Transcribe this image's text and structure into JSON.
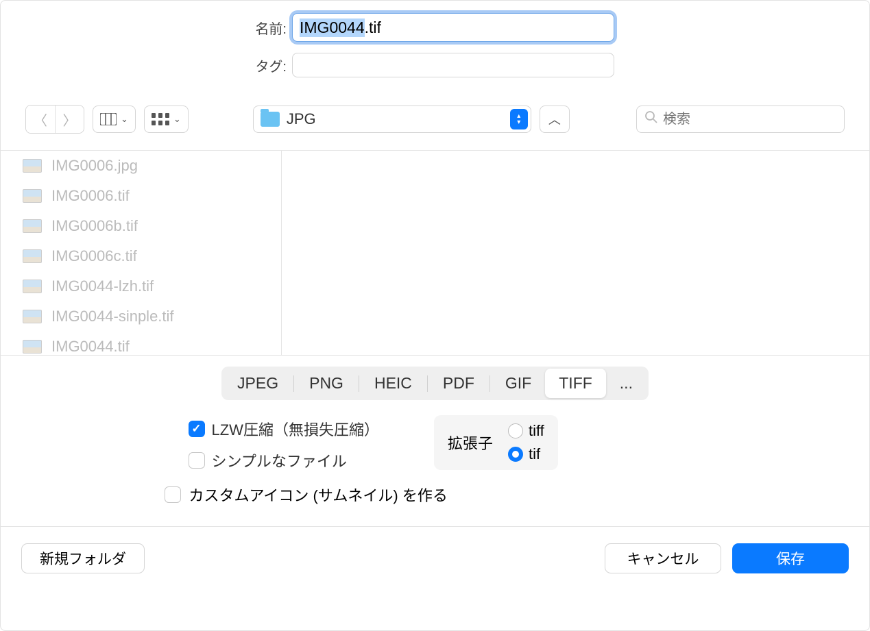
{
  "labels": {
    "name": "名前:",
    "tags": "タグ:"
  },
  "filename": "IMG0044.tif",
  "folder": "JPG",
  "search_placeholder": "検索",
  "files": [
    "IMG0006.jpg",
    "IMG0006.tif",
    "IMG0006b.tif",
    "IMG0006c.tif",
    "IMG0044-lzh.tif",
    "IMG0044-sinple.tif",
    "IMG0044.tif"
  ],
  "formats": {
    "jpeg": "JPEG",
    "png": "PNG",
    "heic": "HEIC",
    "pdf": "PDF",
    "gif": "GIF",
    "tiff": "TIFF",
    "more": "..."
  },
  "active_format": "tiff",
  "options": {
    "lzw": "LZW圧縮（無損失圧縮）",
    "simple": "シンプルなファイル",
    "custom_icon": "カスタムアイコン (サムネイル) を作る"
  },
  "ext": {
    "label": "拡張子",
    "tiff": "tiff",
    "tif": "tif"
  },
  "buttons": {
    "new_folder": "新規フォルダ",
    "cancel": "キャンセル",
    "save": "保存"
  }
}
